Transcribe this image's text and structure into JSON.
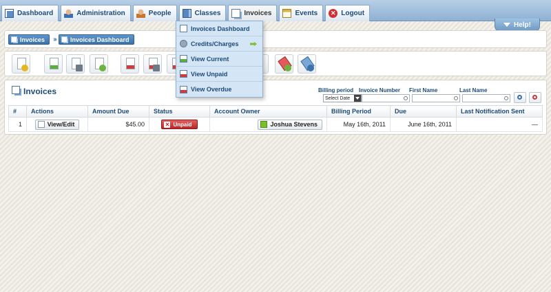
{
  "nav": {
    "tabs": [
      {
        "label": "Dashboard",
        "icon": "dashboard-icon"
      },
      {
        "label": "Administration",
        "icon": "administration-icon"
      },
      {
        "label": "People",
        "icon": "people-icon"
      },
      {
        "label": "Classes",
        "icon": "classes-icon"
      },
      {
        "label": "Invoices",
        "icon": "invoices-icon"
      },
      {
        "label": "Events",
        "icon": "events-icon"
      },
      {
        "label": "Logout",
        "icon": "logout-icon"
      }
    ],
    "active": "Invoices"
  },
  "help": {
    "label": "Help!"
  },
  "breadcrumb": {
    "items": [
      "Invoices",
      "Invoices Dashboard"
    ]
  },
  "dropdown": {
    "items": [
      "Invoices Dashboard",
      "Credits/Charges",
      "View Current",
      "View Unpaid",
      "View Overdue"
    ]
  },
  "invoices": {
    "title": "Invoices",
    "filters": {
      "billing_period_label": "Billing period",
      "billing_period_value": "Select Date",
      "invoice_number_label": "Invoice Number",
      "first_name_label": "First Name",
      "last_name_label": "Last Name"
    },
    "columns": [
      "#",
      "Actions",
      "Amount Due",
      "Status",
      "Account Owner",
      "Billing Period",
      "Due",
      "Last Notification Sent"
    ],
    "rows": [
      {
        "num": "1",
        "action": "View/Edit",
        "amount": "$45.00",
        "status": "Unpaid",
        "owner": "Joshua Stevens",
        "billing_period": "May 16th, 2011",
        "due": "June 16th, 2011",
        "last_notification": "—"
      }
    ]
  },
  "colors": {
    "accent": "#3b72aa",
    "status_unpaid": "#c62b2b",
    "menu_bg": "#d4e6f5"
  }
}
